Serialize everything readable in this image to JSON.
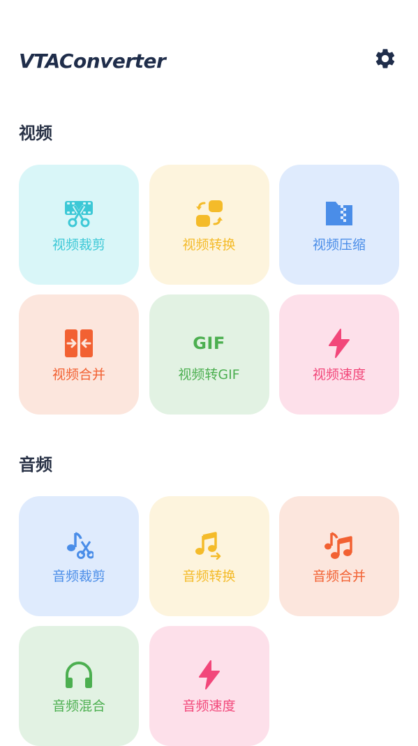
{
  "header": {
    "title": "VTAConverter",
    "settings_icon": "gear-icon",
    "title_color": "#1f2d4a"
  },
  "sections": [
    {
      "title": "视频",
      "tiles": [
        {
          "label": "视频裁剪",
          "icon": "film-scissors-icon",
          "bg": "#d9f6f8",
          "fg": "#3cc8d6"
        },
        {
          "label": "视频转换",
          "icon": "convert-blocks-icon",
          "bg": "#fdf4dd",
          "fg": "#f4bb2a"
        },
        {
          "label": "视频压缩",
          "icon": "zip-file-icon",
          "bg": "#dfebfd",
          "fg": "#4a8de8"
        },
        {
          "label": "视频合并",
          "icon": "merge-arrows-icon",
          "bg": "#fce6dd",
          "fg": "#f26132"
        },
        {
          "label": "视频转GIF",
          "icon": "gif-icon",
          "icon_text": "GIF",
          "bg": "#e2f2e3",
          "fg": "#4caf50"
        },
        {
          "label": "视频速度",
          "icon": "lightning-icon",
          "bg": "#fde0ea",
          "fg": "#f2477a"
        }
      ]
    },
    {
      "title": "音频",
      "tiles": [
        {
          "label": "音频裁剪",
          "icon": "music-scissors-icon",
          "bg": "#dfebfd",
          "fg": "#4a8de8"
        },
        {
          "label": "音频转换",
          "icon": "music-convert-icon",
          "bg": "#fdf4dd",
          "fg": "#f4bb2a"
        },
        {
          "label": "音频合并",
          "icon": "music-notes-icon",
          "bg": "#fce6dd",
          "fg": "#f26132"
        },
        {
          "label": "音频混合",
          "icon": "headphones-icon",
          "bg": "#e2f2e3",
          "fg": "#4caf50"
        },
        {
          "label": "音频速度",
          "icon": "lightning-icon",
          "bg": "#fde0ea",
          "fg": "#f2477a"
        }
      ]
    }
  ]
}
